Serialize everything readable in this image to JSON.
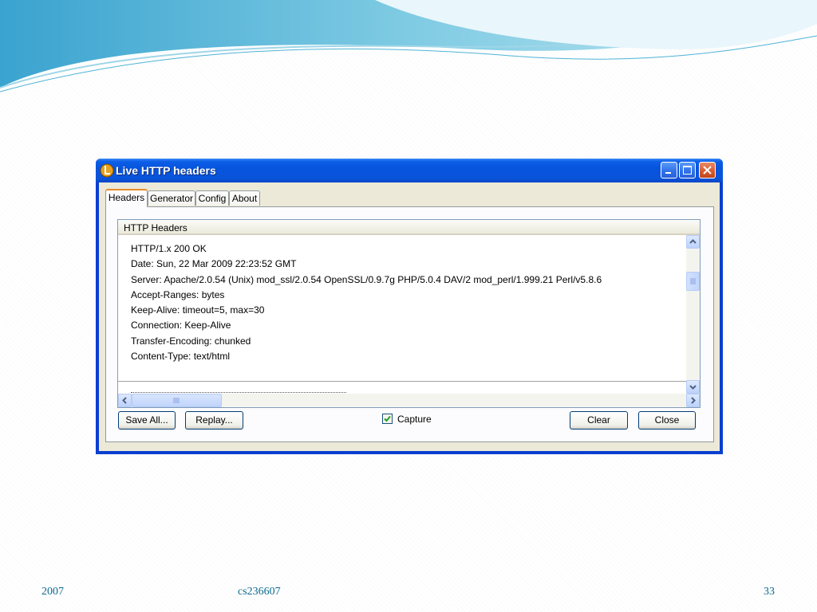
{
  "window": {
    "title": "Live HTTP headers"
  },
  "tabs": [
    {
      "label": "Headers",
      "active": true
    },
    {
      "label": "Generator",
      "active": false
    },
    {
      "label": "Config",
      "active": false
    },
    {
      "label": "About",
      "active": false
    }
  ],
  "headers_panel": {
    "column_header": "HTTP Headers",
    "lines": [
      "HTTP/1.x 200 OK",
      "Date: Sun, 22 Mar 2009 22:23:52 GMT",
      "Server: Apache/2.0.54 (Unix) mod_ssl/2.0.54 OpenSSL/0.9.7g PHP/5.0.4 DAV/2 mod_perl/1.999.21 Perl/v5.8.6",
      "Accept-Ranges: bytes",
      "Keep-Alive: timeout=5, max=30",
      "Connection: Keep-Alive",
      "Transfer-Encoding: chunked",
      "Content-Type: text/html"
    ]
  },
  "buttons": {
    "save_all": "Save All...",
    "replay": "Replay...",
    "clear": "Clear",
    "close": "Close"
  },
  "capture": {
    "label": "Capture",
    "checked": true
  },
  "footer": {
    "year": "2007",
    "course": "cs236607",
    "page": "33"
  },
  "colors": {
    "titlebar": "#0a54db",
    "window_face": "#ece9d8",
    "active_tab_accent": "#e68b2c",
    "footer_text": "#0b6a8e"
  }
}
